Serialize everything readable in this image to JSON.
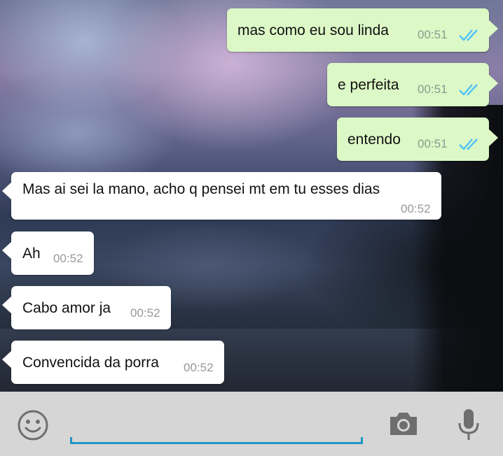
{
  "messages": [
    {
      "direction": "out",
      "text": "mas como eu sou linda",
      "time": "00:51",
      "status": "read"
    },
    {
      "direction": "out",
      "text": "e perfeita",
      "time": "00:51",
      "status": "read"
    },
    {
      "direction": "out",
      "text": "entendo",
      "time": "00:51",
      "status": "read"
    },
    {
      "direction": "in",
      "text": "Mas ai sei la mano, acho q pensei mt em tu esses dias",
      "time": "00:52"
    },
    {
      "direction": "in",
      "text": "Ah",
      "time": "00:52"
    },
    {
      "direction": "in",
      "text": "Cabo amor ja",
      "time": "00:52"
    },
    {
      "direction": "in",
      "text": "Convencida da porra",
      "time": "00:52"
    }
  ],
  "composer": {
    "value": "",
    "emoji_icon": "smiley-icon",
    "camera_icon": "camera-icon",
    "mic_icon": "microphone-icon"
  },
  "colors": {
    "outgoing_bubble": "#dcf8c6",
    "incoming_bubble": "#ffffff",
    "read_ticks": "#4fc3f7",
    "input_accent": "#2196c6",
    "input_bar": "#d6d6d6"
  }
}
